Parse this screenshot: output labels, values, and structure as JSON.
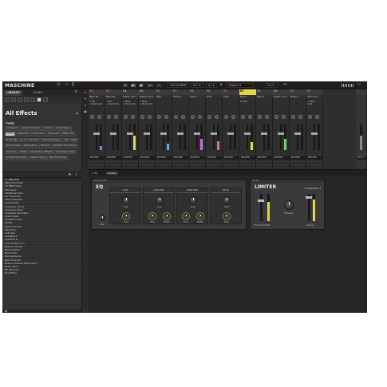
{
  "app": {
    "logo": "MASCHINE"
  },
  "topbar": {
    "tempo": "120.00 BPM",
    "swing": "0.0 %",
    "signature": "4 / 4",
    "scene": "Scene 11",
    "position": "1:1:1"
  },
  "library": {
    "tabs": [
      "LIBRARY",
      "FILES"
    ],
    "section_title": "All Effects",
    "types_label": "TYPES",
    "tags": [
      "Ambience",
      "Amp Simulator",
      "Chorus",
      "Compressor",
      "Delay",
      "Distortion",
      "Dynamics",
      "Enhancer",
      "Filter Mix",
      "Bass MR",
      "Lo-Fi",
      "Panning",
      "Phaser/Flanger",
      "Pitch Shift",
      "Re-Sampler",
      "Resonance",
      "Reverb",
      "Speaker Emulation",
      "Tremolo",
      "Utility",
      "Modulation Effects",
      "Multi Tap Delay",
      "Single Tap Delay",
      "Stereo Delay",
      "Spectral Delay"
    ],
    "selected_tag": "Delay",
    "results": [
      "2c (RB) Dist",
      "8Bit Arithmetik",
      "10 MBit Delay",
      "80s Spine",
      "Additional Tone",
      "Air Ensemble",
      "Altered Bodies",
      "Analog Dist",
      "Analogue Chord",
      "Analogue Moon",
      "Analogue Simulator",
      "Angel Delay",
      "Angelshimmer",
      "Aphex",
      "Asymmetrizer",
      "Attentiva",
      "Auto Pan",
      "AutoBell 8",
      "AutoDub 8",
      "Auto Drifter in Q",
      "Backing Vocals",
      "Band Delays",
      "Bandy Pay",
      "Bandyshands",
      "Bat Enhancer",
      "Bottom Garage Elimination",
      "Brass Rock",
      "BX Enhance",
      "Boat Echo"
    ]
  },
  "mixer": {
    "channels": [
      {
        "id": "A1",
        "name": "Base Kit",
        "color": "#e25b5b",
        "inserts": [
          "+ EQ",
          "+ Maximizer"
        ],
        "level": 0.15,
        "meter_color": "#6a8ed8"
      },
      {
        "id": "B1",
        "name": "Base Kit",
        "color": "#e25b5b",
        "inserts": [
          "+ EQ",
          "+ Maximizer"
        ],
        "level": 0.0,
        "meter_color": "#d86a6a"
      },
      {
        "id": "C1",
        "name": "Shaker 60-1",
        "color": "#dfcf48",
        "inserts": [
          "+ Base",
          "+ Maximizer"
        ],
        "level": 0.55,
        "meter_color": "#e6d64a"
      },
      {
        "id": "D1",
        "name": "Shaker 60-2",
        "color": "#6fd26f",
        "inserts": [
          "+ Base",
          "+ Maximizer"
        ],
        "level": 0.0,
        "meter_color": "#6fd26f"
      },
      {
        "id": "E1",
        "name": "Wfit",
        "color": "#6a8ed8",
        "inserts": [],
        "level": 0.25,
        "meter_color": "#4ab5e6"
      },
      {
        "id": "F1",
        "name": "Shimm",
        "color": "#b07de0",
        "inserts": [],
        "level": 0.0,
        "meter_color": "#b07de0"
      },
      {
        "id": "G1",
        "name": "Shock",
        "color": "#b07de0",
        "inserts": [],
        "level": 0.45,
        "meter_color": "#c46fe0"
      },
      {
        "id": "H1",
        "name": "Hiha",
        "color": "#d86ad8",
        "inserts": [],
        "level": 0.35,
        "meter_color": "#d86ab8"
      },
      {
        "id": "A2",
        "name": "Seek",
        "color": "#e25b5b",
        "inserts": [],
        "level": 0.0,
        "meter_color": "#e25b5b"
      },
      {
        "id": "B2",
        "name": "Bass 1",
        "color": "#e6d64a",
        "inserts": [
          "Limiter"
        ],
        "level": 0.3,
        "meter_color": "#e6d64a",
        "selected": true
      },
      {
        "id": "C2",
        "name": "Bass 2",
        "color": "#6fd26f",
        "inserts": [],
        "level": 0.0,
        "meter_color": "#6fd26f"
      },
      {
        "id": "D2",
        "name": "Synth- coun",
        "color": "#6fd26f",
        "inserts": [],
        "level": 0.45,
        "meter_color": "#6fd26f"
      },
      {
        "id": "E2",
        "name": "Brass 3",
        "color": "#6a8ed8",
        "inserts": [],
        "level": 0.0,
        "meter_color": "#6a8ed8"
      },
      {
        "id": "F2",
        "name": "Sound F2",
        "color": "#b07de0",
        "inserts": [
          "+ Base",
          "Limit"
        ],
        "level": 0.0,
        "meter_color": "#b07de0"
      }
    ],
    "master_label": "MASTER",
    "out_label": "OUT 1"
  },
  "plugin_strip": {
    "items": [
      "+ FX",
      "Limiter"
    ]
  },
  "devices": {
    "eq": {
      "title": "EQ",
      "top_label": "Transient EQ",
      "bands": [
        {
          "name": "LOW",
          "knobs": [
            {
              "label": "Gain",
              "value": 0.5
            },
            {
              "label": "Freq",
              "value": 0.45
            }
          ]
        },
        {
          "name": "LOW-MID",
          "knobs": [
            {
              "label": "Gain",
              "value": 0.5
            },
            {
              "label": "Freq",
              "value": 0.5
            },
            {
              "label": "Width",
              "value": 0.5
            }
          ]
        },
        {
          "name": "HIGH-MID",
          "knobs": [
            {
              "label": "Gain",
              "value": 0.5
            },
            {
              "label": "Freq",
              "value": 0.5
            },
            {
              "label": "Width",
              "value": 0.5
            }
          ]
        },
        {
          "name": "HIGH",
          "knobs": [
            {
              "label": "Gain",
              "value": 0.5
            },
            {
              "label": "Freq",
              "value": 0.55
            }
          ]
        }
      ],
      "extra_label": "Gain"
    },
    "limiter": {
      "title": "LIMITER",
      "top_label": "Limiter",
      "preset": "Transparent 1",
      "threshold_label": "Threshold",
      "threshold_value": "0dB",
      "release_label": "Release",
      "ceiling_label": "Ceiling",
      "gr_level": 0.7
    }
  }
}
